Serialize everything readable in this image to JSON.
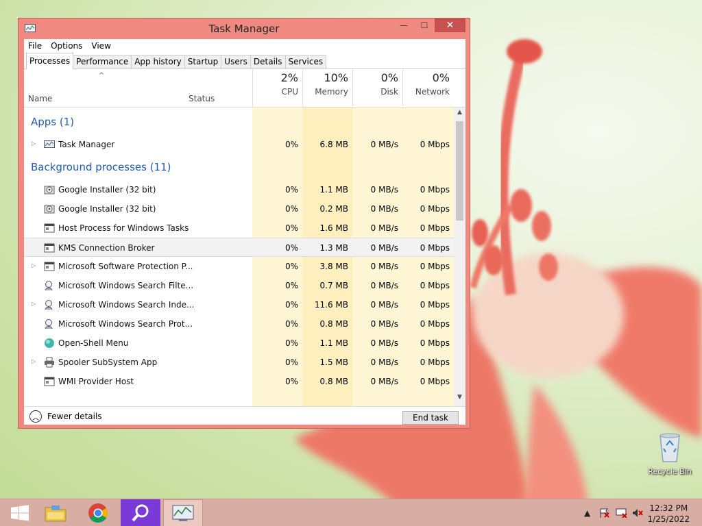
{
  "window": {
    "title": "Task Manager"
  },
  "menu": [
    "File",
    "Options",
    "View"
  ],
  "tabs": [
    "Processes",
    "Performance",
    "App history",
    "Startup",
    "Users",
    "Details",
    "Services"
  ],
  "header": {
    "sort_arrow": "^",
    "name": "Name",
    "status": "Status",
    "cpu_pct": "2%",
    "cpu": "CPU",
    "mem_pct": "10%",
    "mem": "Memory",
    "disk_pct": "0%",
    "disk": "Disk",
    "net_pct": "0%",
    "net": "Network"
  },
  "groups": {
    "apps": "Apps (1)",
    "background": "Background processes (11)"
  },
  "apps": [
    {
      "name": "Task Manager",
      "cpu": "0%",
      "mem": "6.8 MB",
      "disk": "0 MB/s",
      "net": "0 Mbps"
    }
  ],
  "background": [
    {
      "name": "Google Installer (32 bit)",
      "cpu": "0%",
      "mem": "1.1 MB",
      "disk": "0 MB/s",
      "net": "0 Mbps"
    },
    {
      "name": "Google Installer (32 bit)",
      "cpu": "0%",
      "mem": "0.2 MB",
      "disk": "0 MB/s",
      "net": "0 Mbps"
    },
    {
      "name": "Host Process for Windows Tasks",
      "cpu": "0%",
      "mem": "1.6 MB",
      "disk": "0 MB/s",
      "net": "0 Mbps"
    },
    {
      "name": "KMS Connection Broker",
      "cpu": "0%",
      "mem": "1.3 MB",
      "disk": "0 MB/s",
      "net": "0 Mbps"
    },
    {
      "name": "Microsoft Software Protection P...",
      "cpu": "0%",
      "mem": "3.8 MB",
      "disk": "0 MB/s",
      "net": "0 Mbps"
    },
    {
      "name": "Microsoft Windows Search Filte...",
      "cpu": "0%",
      "mem": "0.7 MB",
      "disk": "0 MB/s",
      "net": "0 Mbps"
    },
    {
      "name": "Microsoft Windows Search Inde...",
      "cpu": "0%",
      "mem": "11.6 MB",
      "disk": "0 MB/s",
      "net": "0 Mbps"
    },
    {
      "name": "Microsoft Windows Search Prot...",
      "cpu": "0%",
      "mem": "0.8 MB",
      "disk": "0 MB/s",
      "net": "0 Mbps"
    },
    {
      "name": "Open-Shell Menu",
      "cpu": "0%",
      "mem": "1.1 MB",
      "disk": "0 MB/s",
      "net": "0 Mbps"
    },
    {
      "name": "Spooler SubSystem App",
      "cpu": "0%",
      "mem": "1.5 MB",
      "disk": "0 MB/s",
      "net": "0 Mbps"
    },
    {
      "name": "WMI Provider Host",
      "cpu": "0%",
      "mem": "0.8 MB",
      "disk": "0 MB/s",
      "net": "0 Mbps"
    }
  ],
  "footer": {
    "fewer_details": "Fewer details",
    "end_task": "End task"
  },
  "desktop": {
    "recycle_bin": "Recycle Bin"
  },
  "taskbar": {
    "time": "12:32 PM",
    "date": "1/25/2022",
    "icons": [
      "windows-start-icon",
      "file-explorer-icon",
      "chrome-icon",
      "search-app-icon",
      "task-manager-icon"
    ]
  },
  "colors": {
    "window_frame": "#ee8a80",
    "group_heading": "#1e5cb0",
    "cpu_col_bg": "#fff6d6",
    "mem_col_bg": "#ffefbf"
  }
}
